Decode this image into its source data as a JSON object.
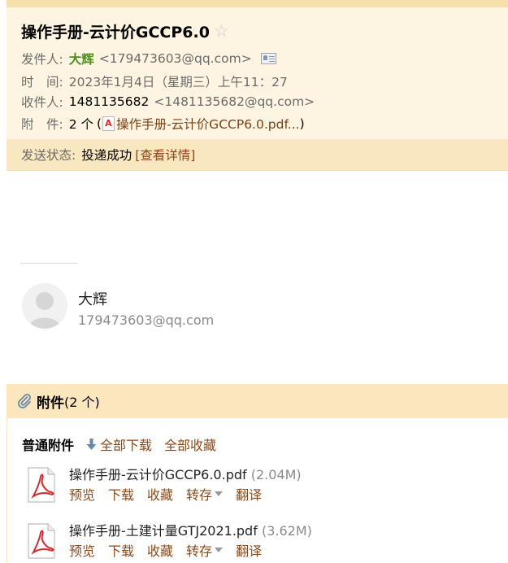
{
  "email": {
    "subject": "操作手册-云计价GCCP6.0",
    "star_icon": "star-outline-icon",
    "from_label": "发件人:",
    "from_name": "大辉",
    "from_addr": "<179473603@qq.com>",
    "contact_card_icon": "contact-card-icon",
    "time_label": "时　间:",
    "time_value": "2023年1月4日（星期三）上午11：27",
    "to_label": "收件人:",
    "to_name": "1481135682",
    "to_addr": "<1481135682@qq.com>",
    "att_label": "附　件:",
    "att_count": "2 个",
    "att_open": "(",
    "att_first": "操作手册-云计价GCCP6.0.pdf...",
    "att_close": ")",
    "status_label": "发送状态:",
    "status_value": "投递成功",
    "status_link": "[查看详情]"
  },
  "signature": {
    "name": "大辉",
    "email": "179473603@qq.com"
  },
  "attachments": {
    "title": "附件",
    "count": "(2 个)",
    "section_title": "普通附件",
    "download_all": "全部下载",
    "save_all": "全部收藏",
    "files": [
      {
        "name": "操作手册-云计价GCCP6.0.pdf",
        "size": "(2.04M)",
        "preview": "预览",
        "download": "下载",
        "favorite": "收藏",
        "save_to": "转存",
        "translate": "翻译"
      },
      {
        "name": "操作手册-土建计量GTJ2021.pdf",
        "size": "(3.62M)",
        "preview": "预览",
        "download": "下载",
        "favorite": "收藏",
        "save_to": "转存",
        "translate": "翻译"
      }
    ]
  },
  "colors": {
    "header_bg": "#fdf5e1",
    "status_bg": "#f9e7bf",
    "sender_green": "#4d8f1e",
    "link_brown": "#8a4a18"
  }
}
